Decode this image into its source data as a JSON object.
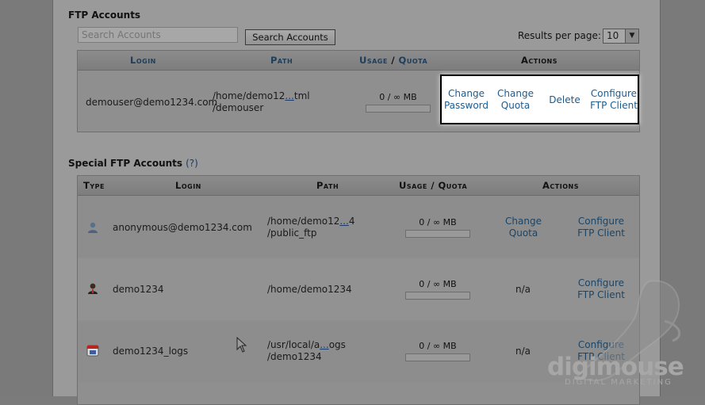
{
  "ftp": {
    "title": "FTP Accounts",
    "search_placeholder": "Search Accounts",
    "search_button": "Search Accounts",
    "results_label": "Results per page:",
    "results_value": "10",
    "headers": {
      "login": "Login",
      "path": "Path",
      "usage": "Usage",
      "slash": " / ",
      "quota": "Quota",
      "actions": "Actions"
    },
    "row": {
      "login": "demouser@demo1234.com",
      "path_a": "/home/demo12",
      "path_ellipsis": "...",
      "path_b": "tml",
      "path_line2": "/demouser",
      "usage": "0 / ∞ MB",
      "usage_fraction": 0,
      "actions": [
        "Change Password",
        "Change Quota",
        "Delete",
        "Configure FTP Client"
      ]
    }
  },
  "special": {
    "title": "Special FTP Accounts",
    "help": "(?)",
    "headers": {
      "type": "Type",
      "login": "Login",
      "path": "Path",
      "usage_quota": "Usage / Quota",
      "actions": "Actions"
    },
    "rows": [
      {
        "icon": "anonymous-user-icon",
        "login": "anonymous@demo1234.com",
        "path_a": "/home/demo12",
        "path_ellipsis": "...",
        "path_b": "4",
        "path_line2": "/public_ftp",
        "usage": "0 / ∞ MB",
        "usage_fraction": 0,
        "action1": "Change Quota",
        "action2": "Configure FTP Client"
      },
      {
        "icon": "main-user-icon",
        "login": "demo1234",
        "path": "/home/demo1234",
        "usage": "0 / ∞ MB",
        "usage_fraction": 0,
        "action1": "n/a",
        "action2": "Configure FTP Client"
      },
      {
        "icon": "logs-icon",
        "login": "demo1234_logs",
        "path_a": "/usr/local/a",
        "path_ellipsis": "...",
        "path_b": "ogs",
        "path_line2": "/demo1234",
        "usage": "0 / ∞ MB",
        "usage_fraction": 0,
        "action1": "n/a",
        "action2": "Configure FTP Client"
      }
    ]
  },
  "watermark": {
    "brand": "digimouse",
    "tagline": "DIGITAL MARKETING"
  }
}
